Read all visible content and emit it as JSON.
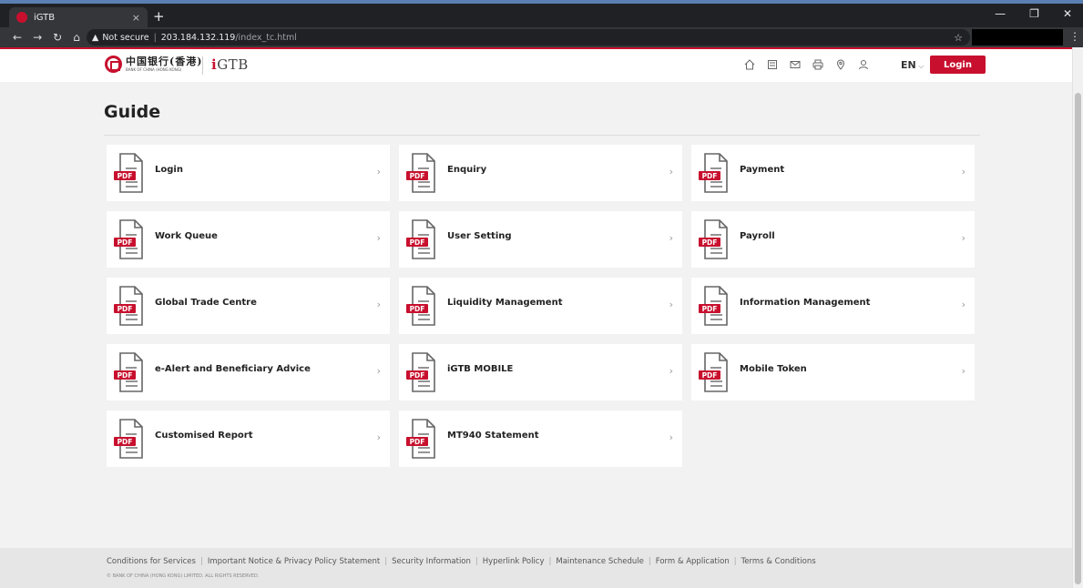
{
  "browser": {
    "tab_title": "iGTB",
    "tab_close": "×",
    "new_tab": "+",
    "security_label": "Not secure",
    "url_host": "203.184.132.119",
    "url_path": "/index_tc.html"
  },
  "header": {
    "bank_name_cn": "中国银行(香港)",
    "bank_name_en": "BANK OF CHINA (HONG KONG)",
    "product_logo": "GTB",
    "product_logo_i": "i",
    "lang": "EN",
    "login_label": "Login"
  },
  "main": {
    "title": "Guide",
    "guides": [
      {
        "label": "Login"
      },
      {
        "label": "Enquiry"
      },
      {
        "label": "Payment"
      },
      {
        "label": "Work Queue"
      },
      {
        "label": "User Setting"
      },
      {
        "label": "Payroll"
      },
      {
        "label": "Global Trade Centre"
      },
      {
        "label": "Liquidity Management"
      },
      {
        "label": "Information Management"
      },
      {
        "label": "e-Alert and Beneficiary Advice"
      },
      {
        "label": "iGTB MOBILE"
      },
      {
        "label": "Mobile Token"
      },
      {
        "label": "Customised Report"
      },
      {
        "label": "MT940 Statement"
      }
    ],
    "pdf_badge": "PDF"
  },
  "footer": {
    "links": [
      "Conditions for Services",
      "Important Notice & Privacy Policy Statement",
      "Security Information",
      "Hyperlink Policy",
      "Maintenance Schedule",
      "Form & Application",
      "Terms & Conditions"
    ],
    "copyright": "© BANK OF CHINA (HONG KONG) LIMITED. ALL RIGHTS RESERVED."
  },
  "colors": {
    "brand_red": "#c8102e"
  }
}
